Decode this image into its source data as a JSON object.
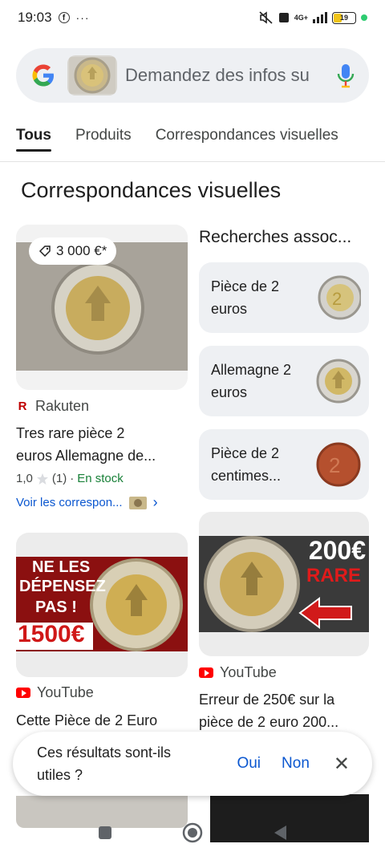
{
  "status_bar": {
    "time": "19:03",
    "fb_glyph": "f",
    "more": "···",
    "network": "4G+",
    "battery": "19"
  },
  "search": {
    "placeholder": "Demandez des infos su",
    "icons": [
      "google-logo",
      "coin-thumbnail",
      "mic-icon"
    ]
  },
  "tabs": [
    {
      "label": "Tous",
      "active": true
    },
    {
      "label": "Produits",
      "active": false
    },
    {
      "label": "Correspondances visuelles",
      "active": false
    }
  ],
  "section_title": "Correspondances visuelles",
  "product_card": {
    "price": "3 000 €*",
    "source": "Rakuten",
    "title_line1": "Tres rare pièce 2",
    "title_line2": "euros Allemagne de...",
    "rating": "1,0",
    "count": "(1)",
    "separator": "·",
    "stock": "En stock",
    "link": "Voir les correspon...",
    "chevron": "›"
  },
  "related": {
    "title": "Recherches assoc...",
    "items": [
      {
        "line1": "Pièce de 2",
        "line2": "euros"
      },
      {
        "line1": "Allemagne 2",
        "line2": "euros"
      },
      {
        "line1": "Pièce de 2",
        "line2": "centimes..."
      }
    ]
  },
  "video_left": {
    "banner_line1": "NE LES",
    "banner_line2": "DÉPENSEZ",
    "banner_line3": "PAS !",
    "banner_price": "1500€",
    "source": "YouTube",
    "title_line1": "Cette Pièce de 2 Euro"
  },
  "video_right": {
    "banner_price": "200€",
    "banner_rare": "RARE",
    "source": "YouTube",
    "title_line1": "Erreur de 250€ sur la",
    "title_line2": "pièce de 2 euro 200..."
  },
  "feedback": {
    "question_line1": "Ces résultats sont-ils",
    "question_line2": "utiles ?",
    "yes": "Oui",
    "no": "Non",
    "close": "✕"
  },
  "colors": {
    "accent": "#0b57d0",
    "stock_green": "#188038",
    "youtube_red": "#ff0000"
  }
}
